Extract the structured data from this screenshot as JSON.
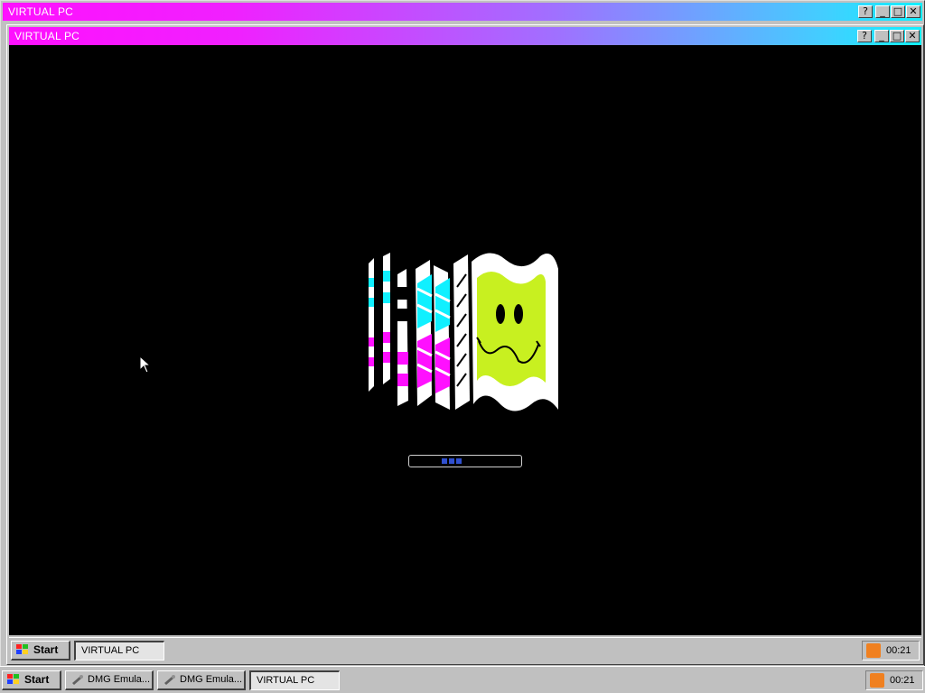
{
  "outer_window": {
    "title": "VIRTUAL PC"
  },
  "inner_window": {
    "title": "VIRTUAL PC"
  },
  "titlebar_buttons": {
    "help": "?",
    "minimize": "_",
    "maximize": "□",
    "close": "✕"
  },
  "icons": {
    "help": "help-icon",
    "minimize": "minimize-icon",
    "maximize": "maximize-icon",
    "close": "close-icon",
    "rss": "rss-icon",
    "start": "windows-logo-icon"
  },
  "boot_screen": {
    "progress_label": ""
  },
  "inner_taskbar": {
    "start_label": "Start",
    "tasks": [
      {
        "label": "VIRTUAL PC",
        "active": false
      }
    ],
    "clock": "00:21"
  },
  "outer_taskbar": {
    "start_label": "Start",
    "tasks": [
      {
        "label": "DMG Emula...",
        "active": false
      },
      {
        "label": "DMG Emula...",
        "active": false
      },
      {
        "label": "VIRTUAL PC",
        "active": true
      }
    ],
    "clock": "00:21"
  },
  "colors": {
    "magenta": "#ff10ff",
    "cyan": "#10f0ff",
    "lime": "#c8f020",
    "screen": "#000000"
  }
}
